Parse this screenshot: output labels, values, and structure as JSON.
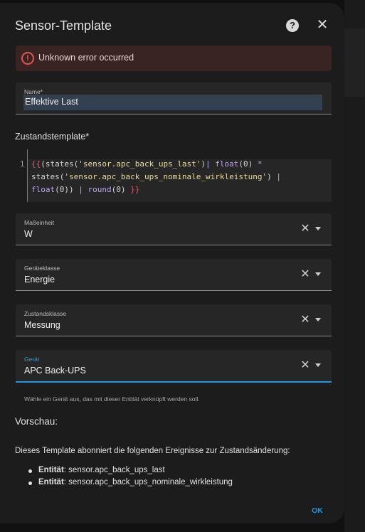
{
  "dialog": {
    "title": "Sensor-Template",
    "help_icon_glyph": "?",
    "close_icon_glyph": "✕"
  },
  "error": {
    "icon_glyph": "!",
    "message": "Unknown error occurred"
  },
  "name_field": {
    "label": "Name*",
    "value": "Effektive Last"
  },
  "template": {
    "label": "Zustandstemplate*",
    "line_number": "1",
    "code_tokens": [
      {
        "cls": "tok-br",
        "text": "{{"
      },
      {
        "cls": "",
        "text": "("
      },
      {
        "cls": "",
        "text": "states("
      },
      {
        "cls": "tok-str",
        "text": "'sensor.apc_back_ups_last'"
      },
      {
        "cls": "",
        "text": ")"
      },
      {
        "cls": "tok-op",
        "text": "|"
      },
      {
        "cls": "tok-fn",
        "text": " float"
      },
      {
        "cls": "",
        "text": "(0) "
      },
      {
        "cls": "tok-op",
        "text": "*"
      },
      {
        "cls": "",
        "text": "\nstates("
      },
      {
        "cls": "tok-str",
        "text": "'sensor.apc_back_ups_nominale_wirkleistung'"
      },
      {
        "cls": "",
        "text": ") "
      },
      {
        "cls": "tok-op",
        "text": "|"
      },
      {
        "cls": "tok-fn",
        "text": "\nfloat"
      },
      {
        "cls": "",
        "text": "(0)) "
      },
      {
        "cls": "tok-op",
        "text": "|"
      },
      {
        "cls": "tok-fn",
        "text": " round"
      },
      {
        "cls": "",
        "text": "(0) "
      },
      {
        "cls": "tok-br",
        "text": "}}"
      }
    ]
  },
  "unit_field": {
    "label": "Maßeinheit",
    "value": "W"
  },
  "device_class_field": {
    "label": "Geräteklasse",
    "value": "Energie"
  },
  "state_class_field": {
    "label": "Zustandsklasse",
    "value": "Messung"
  },
  "device_field": {
    "label": "Gerät",
    "value": "APC Back-UPS",
    "helper": "Wähle ein Gerät aus, das mit dieser Entität verknüpft werden soll."
  },
  "clear_icon_glyph": "✕",
  "preview": {
    "heading": "Vorschau:",
    "description": "Dieses Template abonniert die folgenden Ereignisse zur Zustandsänderung:",
    "entities": [
      {
        "key": "Entität",
        "value": ": sensor.apc_back_ups_last"
      },
      {
        "key": "Entität",
        "value": ": sensor.apc_back_ups_nominale_wirkleistung"
      }
    ]
  },
  "ok_button": {
    "label": "OK"
  },
  "colors": {
    "accent": "#1e9ae5",
    "error": "#e45550",
    "dialog_bg": "#1c1c1c",
    "field_bg": "#262626"
  }
}
